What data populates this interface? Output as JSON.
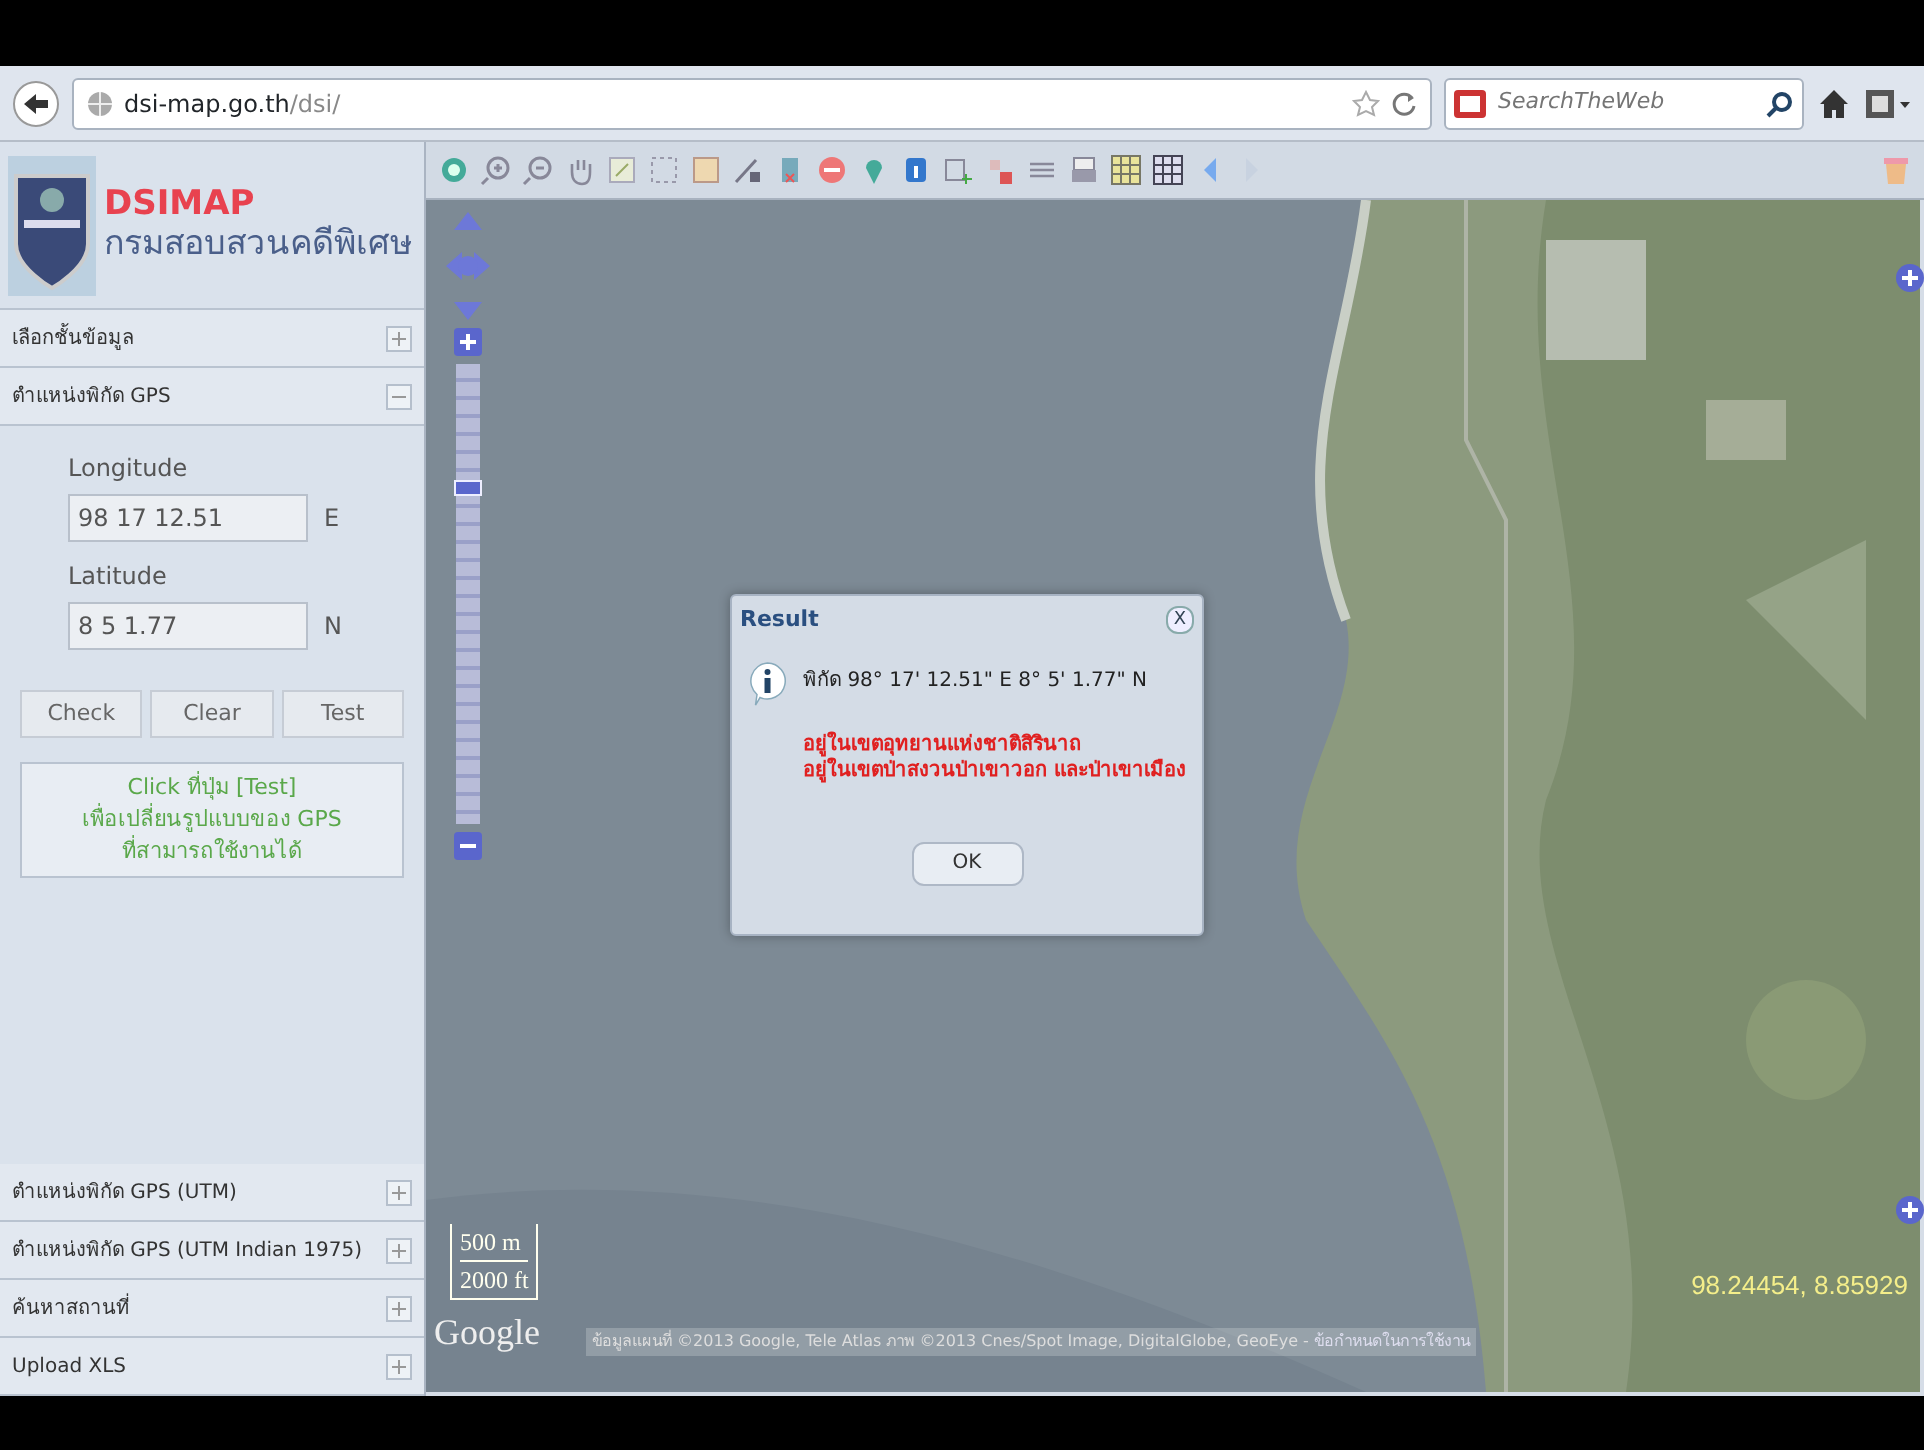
{
  "browser": {
    "url_host": "dsi-map.go.th",
    "url_path": "/dsi/",
    "search_placeholder": "SearchTheWeb"
  },
  "sidebar": {
    "logo_title": "DSIMAP",
    "logo_subtitle": "กรมสอบสวนคดีพิเศษ",
    "sections_top": [
      {
        "label": "เลือกชั้นข้อมูล",
        "expanded": false
      },
      {
        "label": "ตำแหน่งพิกัด GPS",
        "expanded": true
      }
    ],
    "gps_form": {
      "longitude_label": "Longitude",
      "longitude_value": "98 17 12.51",
      "longitude_unit": "E",
      "latitude_label": "Latitude",
      "latitude_value": "8 5 1.77",
      "latitude_unit": "N",
      "buttons": [
        "Check",
        "Clear",
        "Test"
      ],
      "hint_lines": [
        "Click ที่ปุ่ม [Test]",
        "เพื่อเปลี่ยนรูปแบบของ GPS",
        "ที่สามารถใช้งานได้"
      ]
    },
    "sections_bottom": [
      {
        "label": "ตำแหน่งพิกัด GPS (UTM)",
        "expanded": false
      },
      {
        "label": "ตำแหน่งพิกัด GPS (UTM Indian 1975)",
        "expanded": false
      },
      {
        "label": "ค้นหาสถานที่",
        "expanded": false
      },
      {
        "label": "Upload XLS",
        "expanded": false
      }
    ]
  },
  "map": {
    "zoom": {
      "level": 0.74
    },
    "scale": [
      "500 m",
      "2000 ft"
    ],
    "logo": "Google",
    "attribution": "ข้อมูลแผนที่ ©2013 Google, Tele Atlas ภาพ ©2013 Cnes/Spot Image, DigitalGlobe, GeoEye -",
    "terms_link": "ข้อกำหนดในการใช้งาน",
    "coordinates": "98.24454, 8.85929"
  },
  "dialog": {
    "title": "Result",
    "close": "X",
    "coordinates": "พิกัด 98° 17' 12.51\" E 8° 5' 1.77\" N",
    "messages": [
      "อยู่ในเขตอุทยานแห่งชาติสิรินาถ",
      "อยู่ในเขตป่าสงวนป่าเขาวอก และป่าเขาเมือง"
    ],
    "ok": "OK"
  }
}
